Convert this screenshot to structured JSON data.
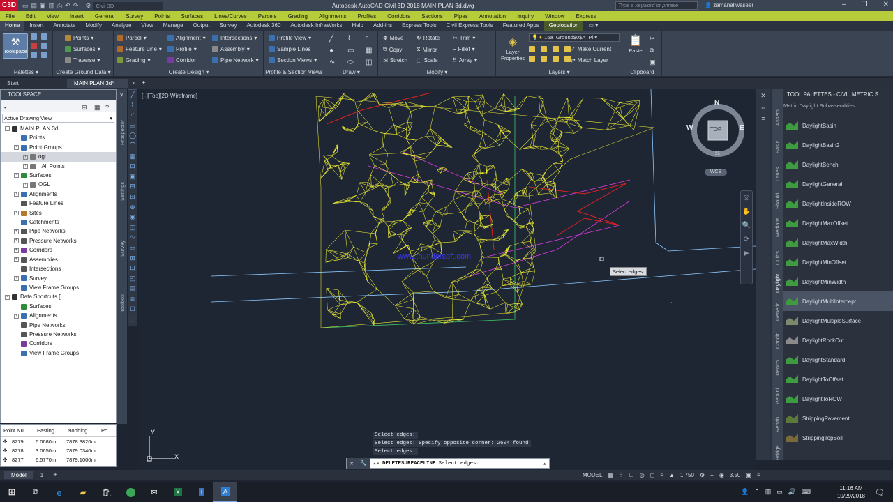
{
  "titlebar": {
    "logo": "C3D",
    "title": "Autodesk AutoCAD Civil 3D 2018    MAIN PLAN 3d.dwg",
    "search_placeholder": "Type a keyword or phrase",
    "user": "zamanaliwaseer",
    "workspace": "Civil 3D"
  },
  "menubar": [
    "File",
    "Edit",
    "View",
    "Insert",
    "General",
    "Survey",
    "Points",
    "Surfaces",
    "Lines/Curves",
    "Parcels",
    "Grading",
    "Alignments",
    "Profiles",
    "Corridors",
    "Sections",
    "Pipes",
    "Annotation",
    "Inquiry",
    "Window",
    "Express"
  ],
  "ribbon_tabs": [
    "Home",
    "Insert",
    "Annotate",
    "Modify",
    "Analyze",
    "View",
    "Manage",
    "Output",
    "Survey",
    "Autodesk 360",
    "Autodesk InfraWorks",
    "Help",
    "Add-ins",
    "Express Tools",
    "Civil Express Tools",
    "Featured Apps",
    "Geolocation"
  ],
  "ribbon": {
    "toolspace": "Toolspace",
    "palettes": "Palettes",
    "ground": {
      "title": "Create Ground Data",
      "items": [
        "Points",
        "Surfaces",
        "Traverse"
      ]
    },
    "design": {
      "title": "Create Design",
      "items": [
        "Parcel",
        "Feature Line",
        "Grading",
        "Alignment",
        "Profile",
        "Corridor",
        "Intersections",
        "Assembly",
        "Pipe Network"
      ]
    },
    "profile": {
      "title": "Profile & Section Views",
      "items": [
        "Profile View",
        "Sample Lines",
        "Section Views"
      ]
    },
    "draw": {
      "title": "Draw"
    },
    "modify": {
      "title": "Modify",
      "items": [
        "Move",
        "Copy",
        "Stretch",
        "Rotate",
        "Mirror",
        "Scale",
        "Trim",
        "Fillet",
        "Array"
      ]
    },
    "layers": {
      "title": "Layers",
      "props": "Layer Properties",
      "current": "16a_Ground$0$A_Pl",
      "items": [
        "Make Current",
        "Match Layer"
      ]
    },
    "clipboard": {
      "title": "Clipboard",
      "paste": "Paste"
    }
  },
  "doc_tabs": [
    "Start",
    "MAIN PLAN 3d*"
  ],
  "toolspace": {
    "title": "TOOLSPACE",
    "view": "Active Drawing View",
    "tree": [
      {
        "label": "MAIN PLAN 3d",
        "level": 0,
        "box": "-",
        "color": "#333"
      },
      {
        "label": "Points",
        "level": 1,
        "box": "",
        "color": "#3a6fb0"
      },
      {
        "label": "Point Groups",
        "level": 1,
        "box": "-",
        "color": "#3a6fb0"
      },
      {
        "label": "ogl",
        "level": 2,
        "box": "+",
        "color": "#777",
        "selected": true
      },
      {
        "label": "_All Points",
        "level": 2,
        "box": "+",
        "color": "#777"
      },
      {
        "label": "Surfaces",
        "level": 1,
        "box": "-",
        "color": "#2f8a3c"
      },
      {
        "label": "OGL",
        "level": 2,
        "box": "+",
        "color": "#777"
      },
      {
        "label": "Alignments",
        "level": 1,
        "box": "+",
        "color": "#3a6fb0"
      },
      {
        "label": "Feature Lines",
        "level": 1,
        "box": "",
        "color": "#555"
      },
      {
        "label": "Sites",
        "level": 1,
        "box": "+",
        "color": "#b07a2a"
      },
      {
        "label": "Catchments",
        "level": 1,
        "box": "",
        "color": "#3a6fb0"
      },
      {
        "label": "Pipe Networks",
        "level": 1,
        "box": "+",
        "color": "#555"
      },
      {
        "label": "Pressure Networks",
        "level": 1,
        "box": "+",
        "color": "#555"
      },
      {
        "label": "Corridors",
        "level": 1,
        "box": "+",
        "color": "#7a3aa0"
      },
      {
        "label": "Assemblies",
        "level": 1,
        "box": "+",
        "color": "#555"
      },
      {
        "label": "Intersections",
        "level": 1,
        "box": "",
        "color": "#555"
      },
      {
        "label": "Survey",
        "level": 1,
        "box": "+",
        "color": "#3a6fb0"
      },
      {
        "label": "View Frame Groups",
        "level": 1,
        "box": "",
        "color": "#3a6fb0"
      },
      {
        "label": "Data Shortcuts []",
        "level": 0,
        "box": "-",
        "color": "#333"
      },
      {
        "label": "Surfaces",
        "level": 1,
        "box": "",
        "color": "#2f8a3c"
      },
      {
        "label": "Alignments",
        "level": 1,
        "box": "+",
        "color": "#3a6fb0"
      },
      {
        "label": "Pipe Networks",
        "level": 1,
        "box": "",
        "color": "#555"
      },
      {
        "label": "Pressure Networks",
        "level": 1,
        "box": "",
        "color": "#555"
      },
      {
        "label": "Corridors",
        "level": 1,
        "box": "",
        "color": "#7a3aa0"
      },
      {
        "label": "View Frame Groups",
        "level": 1,
        "box": "",
        "color": "#3a6fb0"
      }
    ],
    "side_tabs": [
      "Prospector",
      "Settings",
      "Survey",
      "Toolbox"
    ]
  },
  "point_table": {
    "headers": [
      "Point Nu...",
      "Easting",
      "Northing",
      "Po"
    ],
    "rows": [
      [
        "8279",
        "6.0680m",
        "7878.3820m"
      ],
      [
        "8278",
        "3.0650m",
        "7879.0340m"
      ],
      [
        "8277",
        "6.5770m",
        "7879.1000m"
      ]
    ]
  },
  "viewport": {
    "label": "[–][Top][2D Wireframe]",
    "watermark": "www.thundersoft.com",
    "tooltip": "Select edges:",
    "viewcube": {
      "n": "N",
      "s": "S",
      "e": "E",
      "w": "W",
      "top": "TOP",
      "wcs": "WCS"
    },
    "ucs_y": "Y",
    "ucs_x": "X"
  },
  "command": {
    "history": [
      "Select edges:",
      "Select edges: Specify opposite corner: 2604 found",
      "Select edges:"
    ],
    "name": "DELETESURFACELINE",
    "prompt": "Select edges:"
  },
  "tool_palette": {
    "title": "TOOL PALETTES - CIVIL METRIC S...",
    "subtitle": "Metric Daylight Subassemblies",
    "items": [
      {
        "label": "DaylightBasin",
        "color": "#3f9b3f"
      },
      {
        "label": "DaylightBasin2",
        "color": "#3f9b3f"
      },
      {
        "label": "DaylightBench",
        "color": "#3f9b3f"
      },
      {
        "label": "DaylightGeneral",
        "color": "#3f9b3f"
      },
      {
        "label": "DaylightInsideROW",
        "color": "#3f9b3f"
      },
      {
        "label": "DaylightMaxOffset",
        "color": "#3f9b3f"
      },
      {
        "label": "DaylightMaxWidth",
        "color": "#3f9b3f"
      },
      {
        "label": "DaylightMinOffset",
        "color": "#3f9b3f"
      },
      {
        "label": "DaylightMinWidth",
        "color": "#3f9b3f"
      },
      {
        "label": "DaylightMultiIntercept",
        "color": "#3f9b3f",
        "selected": true
      },
      {
        "label": "DaylightMultipleSurface",
        "color": "#7a8a6a"
      },
      {
        "label": "DaylightRockCut",
        "color": "#8a8a8a"
      },
      {
        "label": "DaylightStandard",
        "color": "#3f9b3f"
      },
      {
        "label": "DaylightToOffset",
        "color": "#3f9b3f"
      },
      {
        "label": "DaylightToROW",
        "color": "#3f9b3f"
      },
      {
        "label": "StrippingPavement",
        "color": "#5b7a3a"
      },
      {
        "label": "StrippingTopSoil",
        "color": "#7a6a3a"
      }
    ],
    "vertical_tabs": [
      "Assem...",
      "Basic",
      "Lanes",
      "Should...",
      "Medians",
      "Curbs",
      "Daylight",
      "Generic",
      "Conditi...",
      "Trench...",
      "Retaini...",
      "Rehab",
      "Bridge"
    ]
  },
  "model_tabs": [
    "Model",
    "1"
  ],
  "statusbar": {
    "mode": "MODEL",
    "scale": "1:750",
    "value": "3.50"
  },
  "taskbar": {
    "time": "11:16 AM",
    "date": "10/29/2018"
  }
}
